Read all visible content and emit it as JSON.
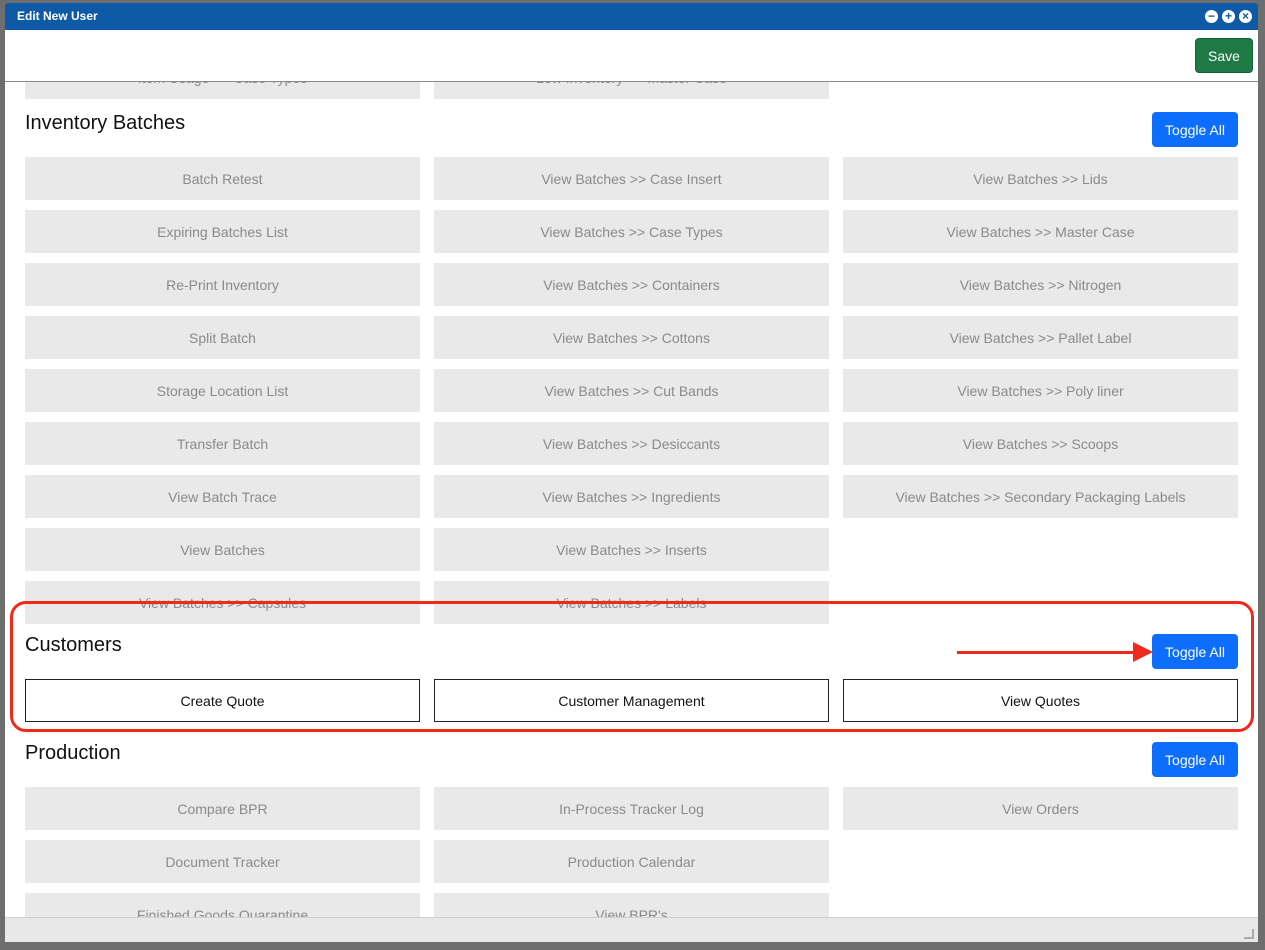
{
  "window": {
    "title": "Edit New User",
    "controls": [
      "minimize-icon",
      "maximize-icon",
      "close-icon"
    ]
  },
  "toolbar": {
    "save_label": "Save"
  },
  "top_partial": {
    "items": [
      "Item Usage >> Case Types",
      "Low Inventory >> Master Case"
    ]
  },
  "inventory_batches": {
    "title": "Inventory Batches",
    "toggle_label": "Toggle All",
    "items": [
      "Batch Retest",
      "View Batches >> Case Insert",
      "View Batches >> Lids",
      "Expiring Batches List",
      "View Batches >> Case Types",
      "View Batches >> Master Case",
      "Re-Print Inventory",
      "View Batches >> Containers",
      "View Batches >> Nitrogen",
      "Split Batch",
      "View Batches >> Cottons",
      "View Batches >> Pallet Label",
      "Storage Location List",
      "View Batches >> Cut Bands",
      "View Batches >> Poly liner",
      "Transfer Batch",
      "View Batches >> Desiccants",
      "View Batches >> Scoops",
      "View Batch Trace",
      "View Batches >> Ingredients",
      "View Batches >> Secondary Packaging Labels",
      "View Batches",
      "View Batches >> Inserts",
      "",
      "View Batches >> Capsules",
      "View Batches >> Labels",
      ""
    ]
  },
  "customers": {
    "title": "Customers",
    "toggle_label": "Toggle All",
    "items": [
      "Create Quote",
      "Customer Management",
      "View Quotes"
    ]
  },
  "production": {
    "title": "Production",
    "toggle_label": "Toggle All",
    "items": [
      "Compare BPR",
      "In-Process Tracker Log",
      "View Orders",
      "Document Tracker",
      "Production Calendar",
      "",
      "Finished Goods Quarantine",
      "View BPR's",
      ""
    ]
  },
  "colors": {
    "title_bar": "#0e5aa7",
    "save": "#1f7a45",
    "toggle": "#0d6efd",
    "highlight": "#f02a1a"
  }
}
